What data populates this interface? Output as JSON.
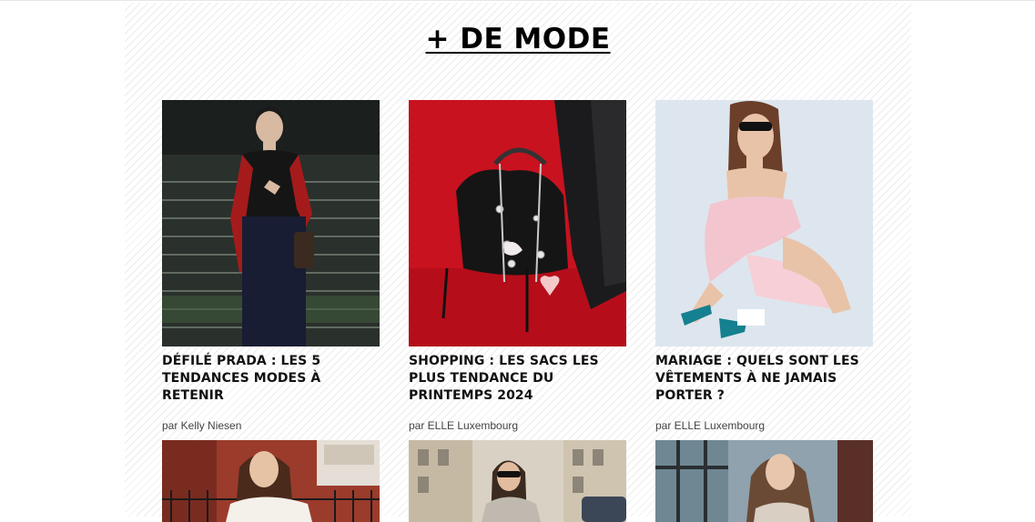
{
  "section": {
    "title": "+ DE MODE"
  },
  "articles": [
    {
      "title": "DÉFILÉ PRADA : LES 5 TENDANCES MODES À RETENIR",
      "byline": "par Kelly Niesen",
      "image": "Model in black sweater with red sleeves walking on runway"
    },
    {
      "title": "SHOPPING : LES SACS LES PLUS TENDANCE DU PRINTEMPS 2024",
      "byline": "par ELLE Luxembourg",
      "image": "Black leather bag with charms on red background"
    },
    {
      "title": "MARIAGE : QUELS SONT LES VÊTEMENTS À NE JAMAIS PORTER ?",
      "byline": "par ELLE Luxembourg",
      "image": "Woman in pink dress and sunglasses sitting"
    }
  ],
  "articles_row2": [
    {
      "image": "Woman in white off-shoulder top in front of brick house"
    },
    {
      "image": "Woman with sunglasses on city street"
    },
    {
      "image": "Woman with long hair by a window"
    }
  ],
  "colors": {
    "text": "#111111",
    "byline": "#444444",
    "pattern": "#ececec"
  }
}
